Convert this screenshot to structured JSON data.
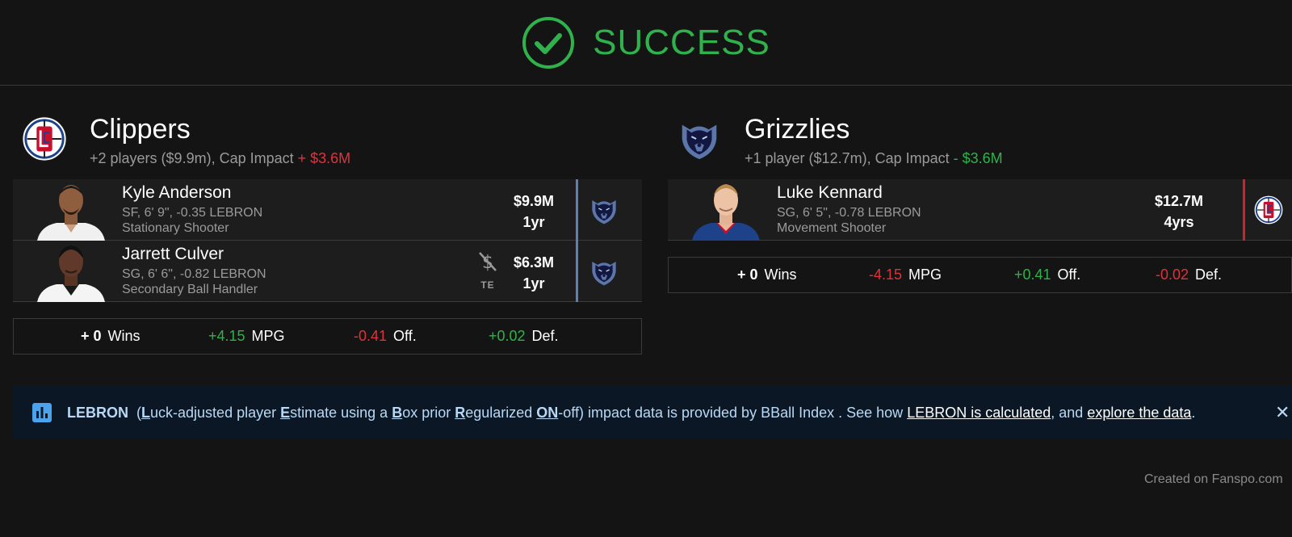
{
  "header": {
    "status_text": "SUCCESS",
    "icon": "check-circle-icon",
    "status_color": "#2fb24c"
  },
  "teams": [
    {
      "name": "Clippers",
      "logo": "clippers-logo",
      "summary_prefix": "+2 players ($9.9m), Cap Impact ",
      "cap_impact": "+ $3.6M",
      "players": [
        {
          "name": "Kyle Anderson",
          "info": "SF, 6' 9\", -0.35 LEBRON",
          "role": "Stationary Shooter",
          "salary": "$9.9M",
          "years": "1yr",
          "destination_logo": "grizzlies-logo"
        },
        {
          "name": "Jarrett Culver",
          "info": "SG, 6' 6\", -0.82 LEBRON",
          "role": "Secondary Ball Handler",
          "salary": "$6.3M",
          "years": "1yr",
          "exception_label": "TE",
          "destination_logo": "grizzlies-logo"
        }
      ],
      "stats": {
        "wins_value": "+ 0",
        "wins_label": "Wins",
        "mpg_value": "+4.15",
        "mpg_label": "MPG",
        "off_value": "-0.41",
        "off_label": "Off.",
        "def_value": "+0.02",
        "def_label": "Def."
      }
    },
    {
      "name": "Grizzlies",
      "logo": "grizzlies-logo",
      "summary_prefix": "+1 player ($12.7m), Cap Impact ",
      "cap_impact": "- $3.6M",
      "players": [
        {
          "name": "Luke Kennard",
          "info": "SG, 6' 5\", -0.78 LEBRON",
          "role": "Movement Shooter",
          "salary": "$12.7M",
          "years": "4yrs",
          "destination_logo": "clippers-logo"
        }
      ],
      "stats": {
        "wins_value": "+ 0",
        "wins_label": "Wins",
        "mpg_value": "-4.15",
        "mpg_label": "MPG",
        "off_value": "+0.41",
        "off_label": "Off.",
        "def_value": "-0.02",
        "def_label": "Def."
      }
    }
  ],
  "banner": {
    "title": "LEBRON",
    "p1": "(",
    "L": "L",
    "t1": "uck-adjusted player ",
    "E": "E",
    "t2": "stimate using a ",
    "B": "B",
    "t3": "ox prior ",
    "R": "R",
    "t4": "egularized ",
    "ON": "ON",
    "t5": "-off) impact data is provided by BBall Index . See how ",
    "link1": "LEBRON is calculated",
    "t6": ", and ",
    "link2": "explore the data",
    "t7": ".",
    "close_glyph": "✕"
  },
  "footer": {
    "credit": "Created on Fanspo.com"
  },
  "colors": {
    "background": "#141414",
    "positive": "#2fb24c",
    "negative": "#e0323c",
    "banner_bg": "#0b1724",
    "grizzlies_blue": "#5f7eb8",
    "clippers_red": "#d4202c"
  }
}
